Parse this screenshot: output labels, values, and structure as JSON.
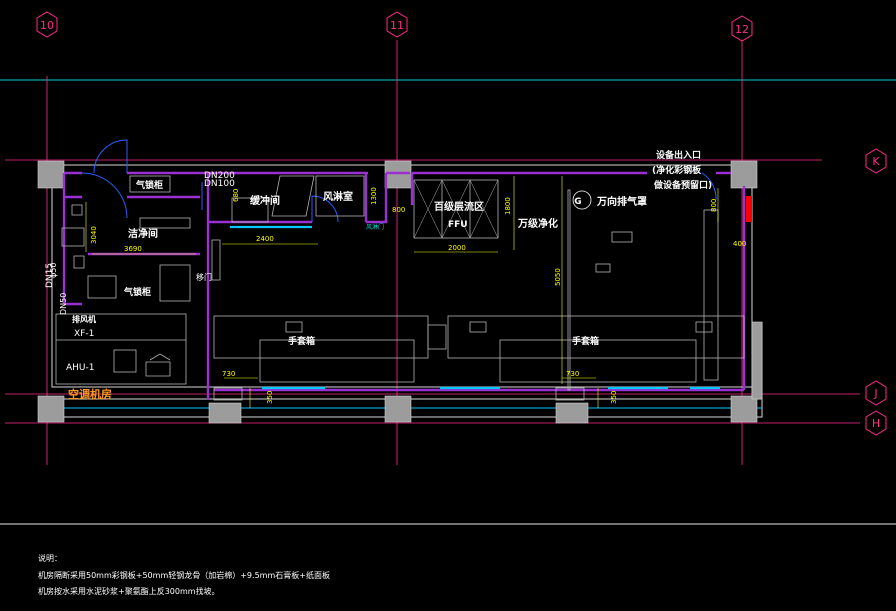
{
  "grid": {
    "columns": [
      "10",
      "11",
      "12"
    ],
    "rows": [
      "K",
      "J",
      "H"
    ]
  },
  "rooms": {
    "buffer": "缓冲间",
    "air_shower_room": "风淋室",
    "clean_room": "洁净间",
    "air_lock_top": "气锁柜",
    "air_lock_bottom": "气锁柜",
    "ffu_zone": "百级层流区",
    "ffu_marker": "FFU",
    "class_10k": "万级净化",
    "universal_hood_num": "G",
    "universal_hood": "万向排气罩",
    "equip_entrance_1": "设备出入口",
    "equip_entrance_2": "(净化彩钢板",
    "equip_entrance_3": "做设备预留口)",
    "glovebox_1": "手套箱",
    "glovebox_2": "手套箱",
    "ahu_room": "空调机房",
    "exhaust_fan": "排风机",
    "xf": "XF-1",
    "ahu": "AHU-1",
    "door_label": "风淋门",
    "door_side": "移门",
    "pipe_label": "DN100",
    "dn": [
      "DN200",
      "DN100",
      "DN15",
      "DN50",
      "φ50"
    ]
  },
  "dimensions": [
    "2400",
    "3690",
    "3040",
    "2000",
    "1800",
    "5050",
    "400",
    "800",
    "1300",
    "730",
    "730",
    "350",
    "350",
    "800",
    "680"
  ],
  "notes": {
    "heading": "说明：",
    "line1": "机房隔断采用50mm彩钢板+50mm轻钢龙骨（加岩棉）+9.5mm石膏板+纸面板",
    "line2": "机房按水采用水泥砂浆+聚氨酯上反300mm找坡。"
  },
  "colors": {
    "background": "#000000",
    "axis": "#ff2c8a",
    "wall": "#9a2fd2",
    "glass": "#00c8ff",
    "dimension": "#ffff00",
    "equipment": "#b4b4b4",
    "text": "#ffffff",
    "accent": "#ff0000",
    "reference": "#00d2d2"
  }
}
